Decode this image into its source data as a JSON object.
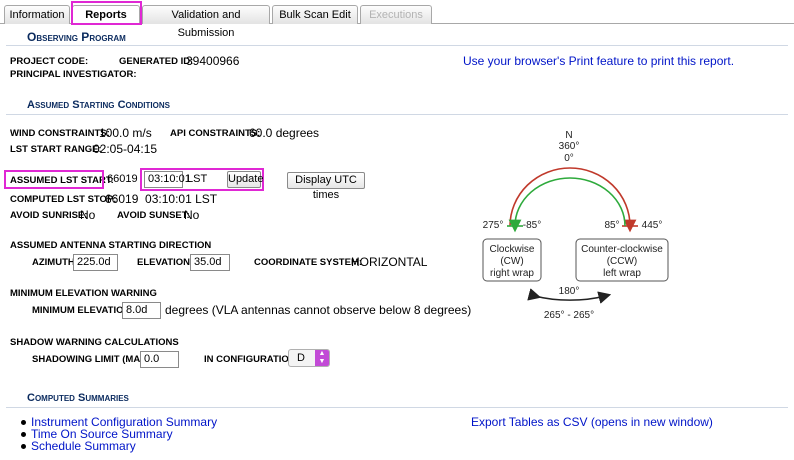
{
  "tabs": [
    {
      "label": "Information"
    },
    {
      "label": "Reports"
    },
    {
      "label": "Validation and Submission"
    },
    {
      "label": "Bulk Scan Edit"
    },
    {
      "label": "Executions"
    }
  ],
  "observing_program": {
    "title": "Observing Program",
    "project_code_label": "PROJECT CODE:",
    "project_code_value": "",
    "generated_id_label": "GENERATED ID:",
    "generated_id_value": "39400966",
    "pi_label": "PRINCIPAL INVESTIGATOR:",
    "pi_value": "",
    "print_hint": "Use your browser's Print feature to print this report."
  },
  "assumed": {
    "title": "Assumed Starting Conditions",
    "wind_label": "WIND CONSTRAINTS:",
    "wind_value": "100.0 m/s",
    "api_label": "API CONSTRAINTS:",
    "api_value": "60.0 degrees",
    "lst_range_label": "LST START RANGE:",
    "lst_range_value": "02:05-04:15",
    "lst_start_label": "ASSUMED LST START:",
    "lst_start_day": "66019",
    "lst_start_time": "03:10:01",
    "lst_suffix": "LST",
    "update_button": "Update",
    "utc_button": "Display UTC times",
    "lst_stop_label": "COMPUTED LST STOP:",
    "lst_stop_value": "66019  03:10:01 LST",
    "avoid_sunrise_label": "AVOID SUNRISE:",
    "avoid_sunrise_value": "No",
    "avoid_sunset_label": "AVOID SUNSET:",
    "avoid_sunset_value": "No",
    "antenna_title": "ASSUMED ANTENNA STARTING DIRECTION",
    "azimuth_label": "AZIMUTH:",
    "azimuth_value": "225.0d",
    "elevation_label": "ELEVATION:",
    "elevation_value": "35.0d",
    "coord_label": "COORDINATE SYSTEM:",
    "coord_value": "HORIZONTAL",
    "min_elev_title": "MINIMUM ELEVATION WARNING",
    "min_elev_label": "MINIMUM ELEVATION:",
    "min_elev_value": "8.0d",
    "min_elev_note": "degrees (VLA antennas cannot observe below 8 degrees)",
    "shadow_title": "SHADOW WARNING CALCULATIONS",
    "shadow_limit_label": "SHADOWING LIMIT (MAX):",
    "shadow_limit_value": "0.0",
    "in_config_label": "IN CONFIGURATION:",
    "in_config_value": "D"
  },
  "diagram": {
    "n": "N",
    "deg360": "360°",
    "deg0": "0°",
    "left_outer": "275°",
    "left_inner": "-85°",
    "right_inner": "85°",
    "right_outer": "445°",
    "cw_line1": "Clockwise",
    "cw_line2": "(CW)",
    "cw_line3": "right wrap",
    "ccw_line1": "Counter-clockwise",
    "ccw_line2": "(CCW)",
    "ccw_line3": "left wrap",
    "bottom": "180°",
    "bottom_range": "265° - 265°",
    "colors": {
      "cw_arc": "#c0392b",
      "ccw_arc": "#2eaa3c"
    }
  },
  "computed": {
    "title": "Computed Summaries",
    "links": [
      {
        "label": "Instrument Configuration Summary"
      },
      {
        "label": "Time On Source Summary"
      },
      {
        "label": "Schedule Summary"
      }
    ],
    "export": "Export Tables as CSV (opens in new window)"
  },
  "colors": {
    "section_title": "#0a2a5e",
    "link": "#0014c8",
    "highlight": "#e028d4"
  }
}
